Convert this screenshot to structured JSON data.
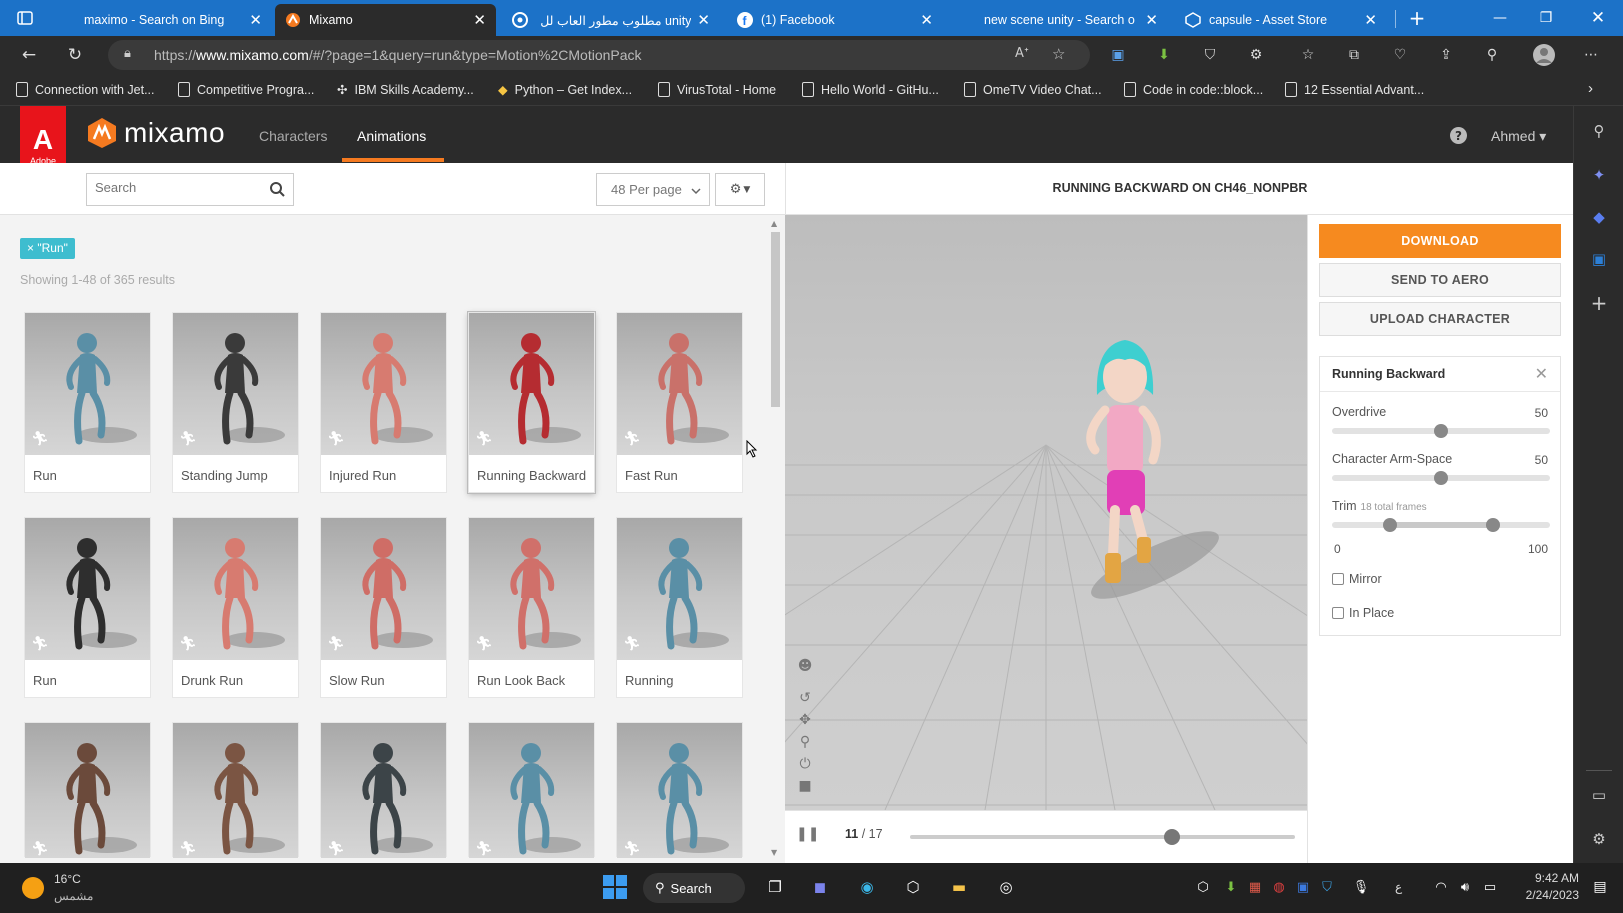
{
  "browser": {
    "tabs": [
      {
        "label": "maximo - Search on Bing",
        "icon": "bing-icon"
      },
      {
        "label": "Mixamo",
        "icon": "mixamo-icon",
        "active": true
      },
      {
        "label": "unity مطلوب مطور العاب لل",
        "icon": "chrome-icon"
      },
      {
        "label": "(1) Facebook",
        "icon": "facebook-icon"
      },
      {
        "label": "new scene unity - Search o",
        "icon": "bing-icon"
      },
      {
        "label": "capsule - Asset Store",
        "icon": "unity-icon"
      }
    ],
    "url_prefix": "https://",
    "url_domain": "www.mixamo.com",
    "url_rest": "/#/?page=1&query=run&type=Motion%2CMotionPack",
    "bookmarks": [
      "Connection with Jet...",
      "Competitive Progra...",
      "IBM Skills Academy...",
      "Python – Get Index...",
      "VirusTotal - Home",
      "Hello World - GitHu...",
      "OmeTV Video Chat...",
      "Code in code::block...",
      "12 Essential Advant..."
    ]
  },
  "mixamo": {
    "adobe_text": "Adobe",
    "logo_text": "mixamo",
    "nav": {
      "characters": "Characters",
      "animations": "Animations"
    },
    "user": "Ahmed",
    "search_placeholder": "Search",
    "per_page": "48 Per page",
    "filter_tag": "× \"Run\"",
    "showing": "Showing 1-48 of 365 results",
    "cards": [
      {
        "label": "Run",
        "color": "#5a8fa6"
      },
      {
        "label": "Standing Jump",
        "color": "#3a3a3a"
      },
      {
        "label": "Injured Run",
        "color": "#d77b70"
      },
      {
        "label": "Running Backward",
        "color": "#b52c31",
        "selected": true
      },
      {
        "label": "Fast Run",
        "color": "#c9716a"
      },
      {
        "label": "Run",
        "color": "#2e2e2e"
      },
      {
        "label": "Drunk Run",
        "color": "#d77b70"
      },
      {
        "label": "Slow Run",
        "color": "#cf6d66"
      },
      {
        "label": "Run Look Back",
        "color": "#d0706a"
      },
      {
        "label": "Running",
        "color": "#5a8fa6"
      },
      {
        "label": "",
        "color": "#6b4a3b"
      },
      {
        "label": "",
        "color": "#7b5543"
      },
      {
        "label": "",
        "color": "#3c4448"
      },
      {
        "label": "",
        "color": "#5a8fa6"
      },
      {
        "label": "",
        "color": "#5a8fa6"
      }
    ],
    "viewer_title": "RUNNING BACKWARD ON CH46_NONPBR",
    "frame_current": "11",
    "frame_total": "/ 17",
    "playback_progress": 0.68,
    "buttons": {
      "download": "DOWNLOAD",
      "send_aero": "SEND TO AERO",
      "upload": "UPLOAD CHARACTER"
    },
    "settings": {
      "title": "Running Backward",
      "overdrive_label": "Overdrive",
      "overdrive_value": "50",
      "armspace_label": "Character Arm-Space",
      "armspace_value": "50",
      "trim_label": "Trim",
      "trim_note": "18 total frames",
      "trim_min": "0",
      "trim_max": "100",
      "mirror": "Mirror",
      "inplace": "In Place"
    }
  },
  "taskbar": {
    "temp": "16°C",
    "weather": "مشمس",
    "search": "Search",
    "lang": "ع",
    "time": "9:42 AM",
    "date": "2/24/2023"
  }
}
